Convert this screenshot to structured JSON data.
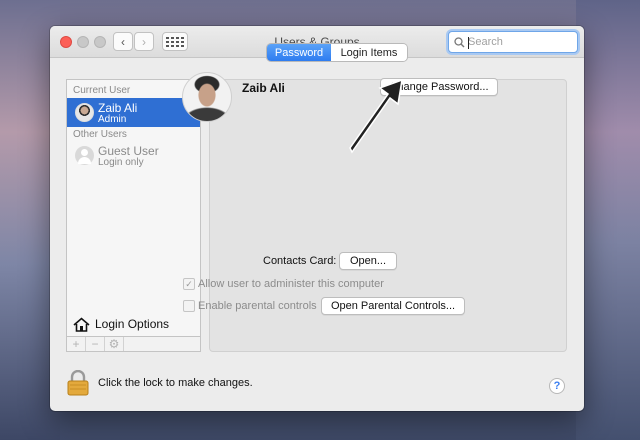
{
  "window": {
    "title": "Users & Groups",
    "search": {
      "placeholder": "Search",
      "value": ""
    }
  },
  "sidebar": {
    "current_heading": "Current User",
    "other_heading": "Other Users",
    "users": [
      {
        "name": "Zaib Ali",
        "role": "Admin",
        "selected": true
      },
      {
        "name": "Guest User",
        "role": "Login only",
        "selected": false
      }
    ],
    "login_options_label": "Login Options",
    "toolbar": {
      "add": "+",
      "remove": "−"
    }
  },
  "main": {
    "tabs": [
      {
        "label": "Password",
        "active": true
      },
      {
        "label": "Login Items",
        "active": false
      }
    ],
    "user_name": "Zaib Ali",
    "change_password_label": "Change Password...",
    "contacts_card_label": "Contacts Card:",
    "open_label": "Open...",
    "allow_admin_label": "Allow user to administer this computer",
    "allow_admin_checked": true,
    "parental_controls_label": "Enable parental controls",
    "parental_controls_checked": false,
    "open_parental_label": "Open Parental Controls..."
  },
  "footer": {
    "lock_text": "Click the lock to make changes.",
    "help_label": "?"
  },
  "colors": {
    "accent": "#2e7cf0",
    "selection": "#2f6fd3",
    "close_button": "#fc5f57"
  }
}
